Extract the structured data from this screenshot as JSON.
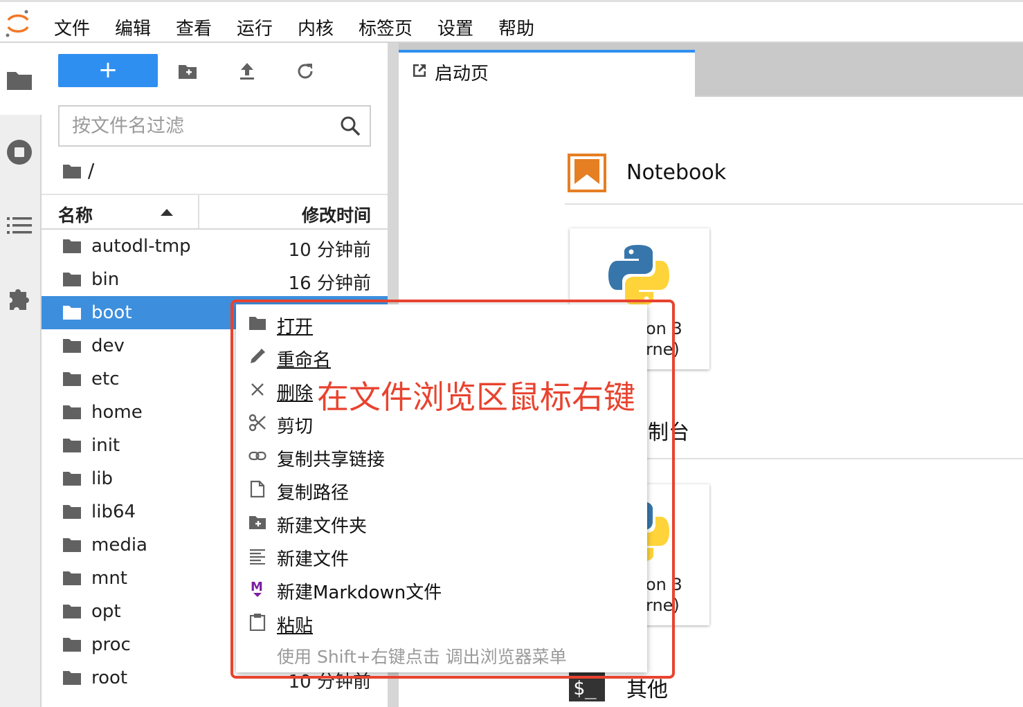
{
  "menubar": {
    "items": [
      "文件",
      "编辑",
      "查看",
      "运行",
      "内核",
      "标签页",
      "设置",
      "帮助"
    ]
  },
  "activity_bar": {
    "icons": [
      "folder-icon",
      "running-icon",
      "toc-icon",
      "extension-icon"
    ]
  },
  "file_browser": {
    "new_button": "+",
    "filter_placeholder": "按文件名过滤",
    "breadcrumb": "/",
    "columns": {
      "name": "名称",
      "modified": "修改时间"
    },
    "files": [
      {
        "name": "autodl-tmp",
        "modified": "10 分钟前"
      },
      {
        "name": "bin",
        "modified": "16 分钟前"
      },
      {
        "name": "boot",
        "modified": "",
        "selected": true
      },
      {
        "name": "dev",
        "modified": ""
      },
      {
        "name": "etc",
        "modified": ""
      },
      {
        "name": "home",
        "modified": ""
      },
      {
        "name": "init",
        "modified": ""
      },
      {
        "name": "lib",
        "modified": ""
      },
      {
        "name": "lib64",
        "modified": ""
      },
      {
        "name": "media",
        "modified": ""
      },
      {
        "name": "mnt",
        "modified": ""
      },
      {
        "name": "opt",
        "modified": ""
      },
      {
        "name": "proc",
        "modified": ""
      },
      {
        "name": "root",
        "modified": "10 分钟前"
      }
    ]
  },
  "main": {
    "tab_label": "启动页",
    "notebook_section": "Notebook",
    "console_section_partial": "制台",
    "other_section_partial": "其他",
    "kernel_card_partial": [
      "on 3",
      "rne)"
    ]
  },
  "context_menu": {
    "items": [
      {
        "icon": "folder-icon",
        "label": "打开"
      },
      {
        "icon": "pencil-icon",
        "label": "重命名"
      },
      {
        "icon": "close-icon",
        "label": "删除"
      },
      {
        "icon": "scissors-icon",
        "label": "剪切"
      },
      {
        "icon": "link-icon",
        "label": "复制共享链接"
      },
      {
        "icon": "file-icon",
        "label": "复制路径"
      },
      {
        "icon": "new-folder-icon",
        "label": "新建文件夹"
      },
      {
        "icon": "text-file-icon",
        "label": "新建文件"
      },
      {
        "icon": "markdown-icon",
        "label": "新建Markdown文件"
      },
      {
        "icon": "clipboard-icon",
        "label": "粘贴"
      }
    ],
    "hint": "使用 Shift+右键点击 调出浏览器菜单"
  },
  "annotation": {
    "text": "在文件浏览区鼠标右键",
    "color": "#e8432f"
  },
  "colors": {
    "accent": "#2f8ff0",
    "selected_row": "#3d8fde",
    "notebook_orange": "#e67e22"
  }
}
